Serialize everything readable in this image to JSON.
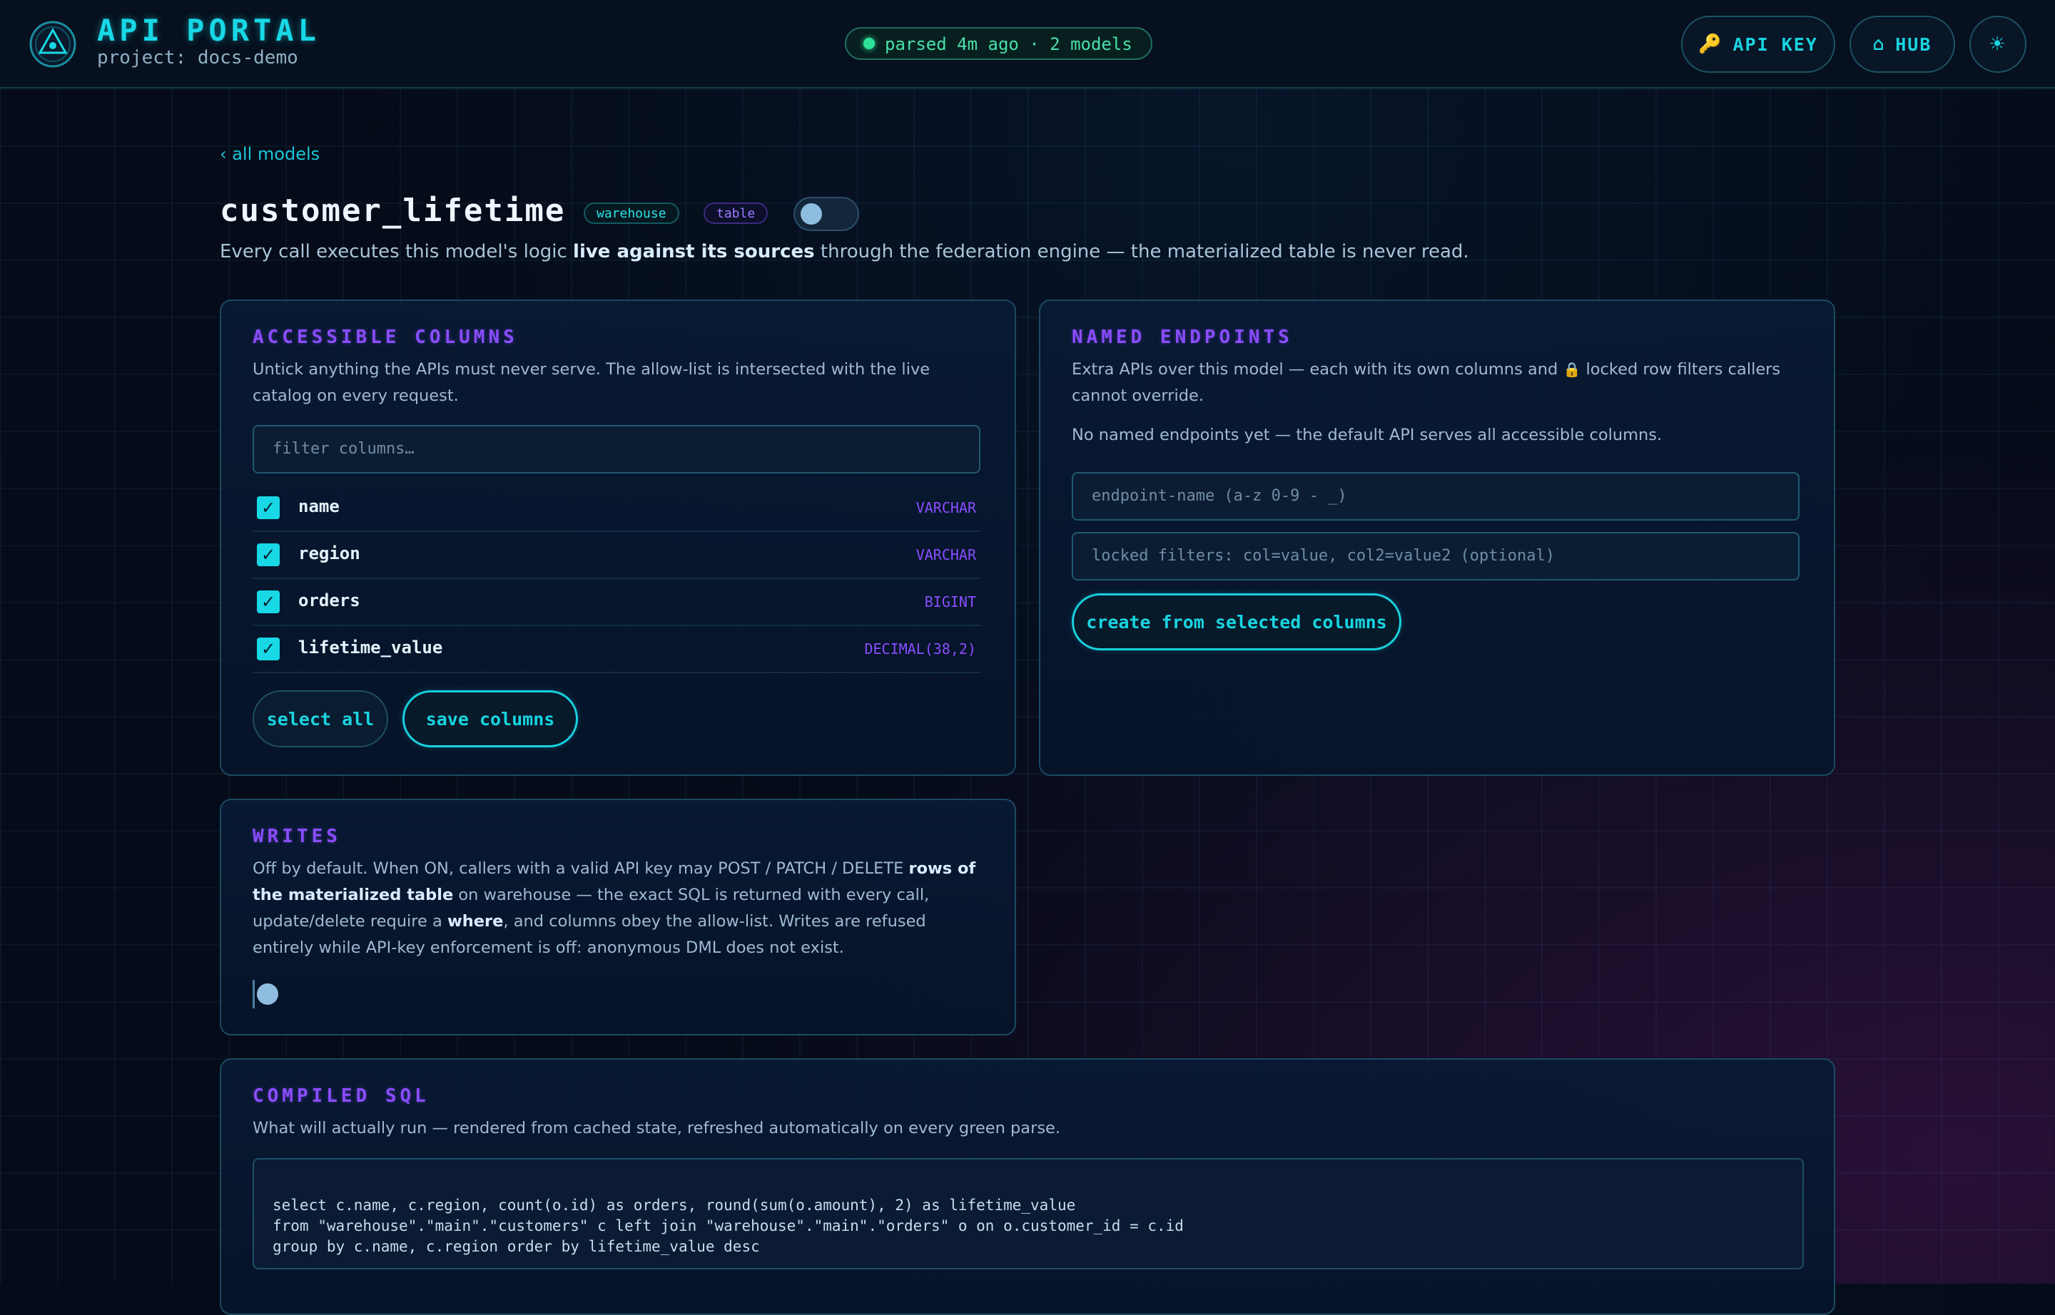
{
  "header": {
    "title": "API PORTAL",
    "project": "project: docs-demo",
    "status": "parsed 4m ago · 2 models",
    "buttons": {
      "api_key": "API KEY",
      "hub": "HUB"
    },
    "icons": {
      "api_key": "🔑",
      "hub": "⌂",
      "theme": "☀"
    }
  },
  "breadcrumb": "‹ all models",
  "model": {
    "name": "customer_lifetime",
    "tags": [
      "warehouse",
      "table"
    ],
    "description_parts": [
      "Every call executes this model's logic ",
      "live against its sources",
      " through the federation engine — the materialized table is never read."
    ]
  },
  "accessible_columns": {
    "title": "ACCESSIBLE COLUMNS",
    "description": "Untick anything the APIs must never serve. The allow-list is intersected with the live catalog on every request.",
    "filter_placeholder": "filter columns…",
    "columns": [
      {
        "name": "name",
        "type": "VARCHAR",
        "checked": true
      },
      {
        "name": "region",
        "type": "VARCHAR",
        "checked": true
      },
      {
        "name": "orders",
        "type": "BIGINT",
        "checked": true
      },
      {
        "name": "lifetime_value",
        "type": "DECIMAL(38,2)",
        "checked": true
      }
    ],
    "select_all": "select all",
    "save": "save columns"
  },
  "named_endpoints": {
    "title": "NAMED ENDPOINTS",
    "description_pre": "Extra APIs over this model — each with its own columns and",
    "lock_icon": "🔒",
    "description_post": "locked row filters callers cannot override.",
    "empty": "No named endpoints yet — the default API serves all accessible columns.",
    "name_placeholder": "endpoint-name (a-z 0-9 - _)",
    "filters_placeholder": "locked filters: col=value, col2=value2 (optional)",
    "create": "create from selected columns"
  },
  "writes": {
    "title": "WRITES",
    "text_parts": [
      "Off by default. When ON, callers with a valid API key may POST / PATCH / DELETE ",
      "rows of the materialized table",
      " on warehouse — the exact SQL is returned with every call, update/delete require a ",
      "where",
      ", and columns obey the allow-list. Writes are refused entirely while API-key enforcement is off: anonymous DML does not exist."
    ],
    "enabled": false
  },
  "compiled_sql": {
    "title": "COMPILED SQL",
    "description": "What will actually run — rendered from cached state, refreshed automatically on every green parse.",
    "lines": [
      "select c.name, c.region, count(o.id) as orders, round(sum(o.amount), 2) as lifetime_value",
      "from \"warehouse\".\"main\".\"customers\" c left join \"warehouse\".\"main\".\"orders\" o on o.customer_id = c.id",
      "group by c.name, c.region order by lifetime_value desc"
    ]
  },
  "colors": {
    "accent": "#18d8e6",
    "section_title": "#8a4dff",
    "status_ok": "#2ee39a"
  }
}
